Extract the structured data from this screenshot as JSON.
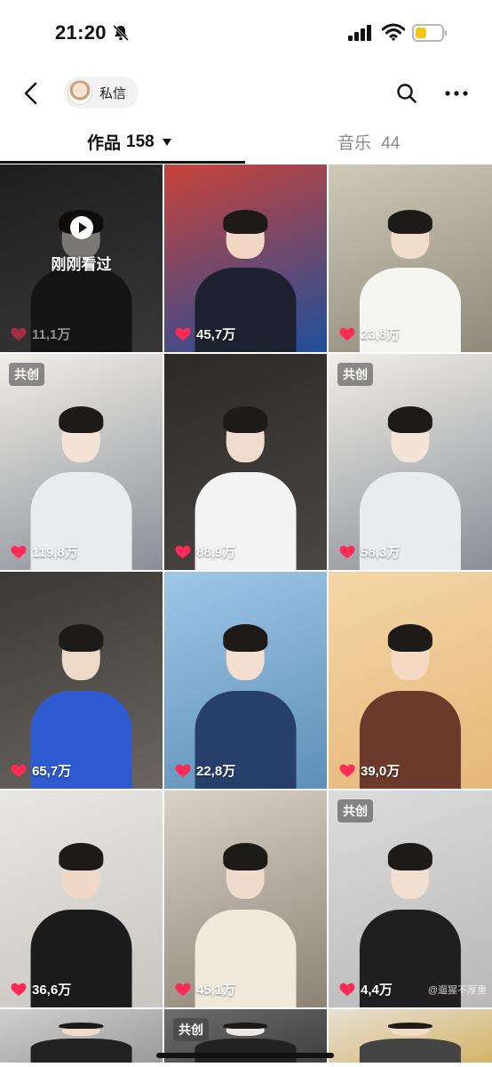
{
  "status_bar": {
    "time": "21:20",
    "icons": [
      "bell-slash-icon",
      "signal-icon",
      "wifi-icon",
      "battery-low-icon"
    ],
    "battery_color": "#f5c518"
  },
  "header": {
    "back_icon": "chevron-left-icon",
    "message_label": "私信",
    "search_icon": "search-icon",
    "more_icon": "more-dots-icon"
  },
  "tabs": [
    {
      "label": "作品",
      "count": "158",
      "active": true
    },
    {
      "label": "音乐",
      "count": "44",
      "active": false
    }
  ],
  "videos": [
    {
      "likes": "11,1万",
      "badge": "",
      "watched_label": "刚刚看过",
      "watermark": "",
      "palette": [
        "#3b3b3b",
        "#6b6b6b",
        "#e9e6e1",
        "#2a2a2a"
      ]
    },
    {
      "likes": "45,7万",
      "badge": "",
      "watched_label": "",
      "watermark": "",
      "palette": [
        "#c9423a",
        "#1f4f9b",
        "#f1d7c4",
        "#1e2230"
      ]
    },
    {
      "likes": "23,8万",
      "badge": "",
      "watched_label": "",
      "watermark": "",
      "palette": [
        "#cfc9b8",
        "#8f8a7a",
        "#f0dccb",
        "#f5f5f2"
      ]
    },
    {
      "likes": "119,8万",
      "badge": "共创",
      "watched_label": "",
      "watermark": "",
      "palette": [
        "#f1eee8",
        "#8a8f97",
        "#f3e2d6",
        "#e9ecef"
      ]
    },
    {
      "likes": "88,9万",
      "badge": "",
      "watched_label": "",
      "watermark": "",
      "palette": [
        "#2c2a28",
        "#4a4642",
        "#efdccd",
        "#f3f3f3"
      ]
    },
    {
      "likes": "58,3万",
      "badge": "共创",
      "watched_label": "",
      "watermark": "",
      "palette": [
        "#f1eee8",
        "#8a8f97",
        "#f3e2d6",
        "#e9ecef"
      ]
    },
    {
      "likes": "65,7万",
      "badge": "",
      "watched_label": "",
      "watermark": "",
      "palette": [
        "#3b3835",
        "#6a6560",
        "#efd9c8",
        "#2f5bd0"
      ]
    },
    {
      "likes": "22,8万",
      "badge": "",
      "watched_label": "",
      "watermark": "",
      "palette": [
        "#9fc7e6",
        "#5d8fb8",
        "#f3dfd0",
        "#27406b"
      ]
    },
    {
      "likes": "39,0万",
      "badge": "",
      "watched_label": "",
      "watermark": "",
      "palette": [
        "#f3d6a6",
        "#e7b77a",
        "#f5d9c2",
        "#6b3a2a"
      ]
    },
    {
      "likes": "36,6万",
      "badge": "",
      "watched_label": "",
      "watermark": "",
      "palette": [
        "#e8e6e3",
        "#c9c5c0",
        "#efd8c8",
        "#1c1c1c"
      ]
    },
    {
      "likes": "45,1万",
      "badge": "",
      "watched_label": "",
      "watermark": "",
      "palette": [
        "#d9d2c7",
        "#8c8376",
        "#efdacb",
        "#efe9dc"
      ]
    },
    {
      "likes": "4,4万",
      "badge": "共创",
      "watched_label": "",
      "watermark": "@遛猩不厚重",
      "palette": [
        "#dcdcdc",
        "#b8b8b8",
        "#f1dfd2",
        "#1f1f1f"
      ]
    },
    {
      "likes": "",
      "badge": "",
      "watched_label": "",
      "watermark": "",
      "palette": [
        "#cfcfcf",
        "#9a9a9a",
        "#efdacb",
        "#222222"
      ]
    },
    {
      "likes": "",
      "badge": "共创",
      "watched_label": "",
      "watermark": "",
      "palette": [
        "#6d6d6d",
        "#3f3f3f",
        "#e9e9e9",
        "#222222"
      ]
    },
    {
      "likes": "",
      "badge": "",
      "watched_label": "",
      "watermark": "",
      "palette": [
        "#e7dfd2",
        "#d3b56a",
        "#f2dcc7",
        "#444444"
      ]
    }
  ],
  "colors": {
    "heart": "#ff2a55",
    "text_primary": "#111111",
    "text_secondary": "#8a8a8a"
  }
}
